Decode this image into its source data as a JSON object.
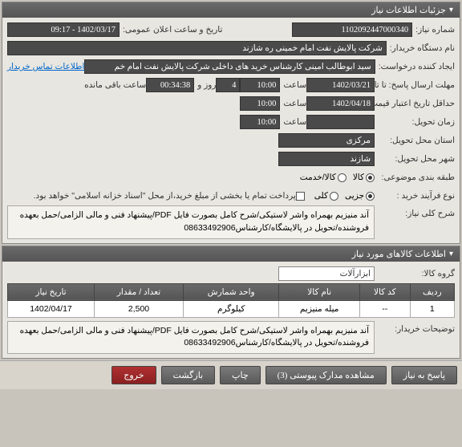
{
  "panels": {
    "detailsTitle": "جزئیات اطلاعات نیاز",
    "goodsTitle": "اطلاعات کالاهای مورد نیاز"
  },
  "labels": {
    "needNo": "شماره نیاز:",
    "buyerOrg": "نام دستگاه خریدار:",
    "requester": "ایجاد کننده درخواست:",
    "sendDue": "مهلت ارسال پاسخ: تا تاریخ:",
    "validFrom": "حداقل تاریخ اعتبار قیمت: تا تاریخ:",
    "deliveryDate": "زمان تحویل:",
    "deliveryProvince": "استان محل تحویل:",
    "deliveryCity": "شهر محل تحویل:",
    "packaging": "طبقه بندی موضوعی:",
    "buyProcess": "نوع فرآیند خرید :",
    "mainDesc": "شرح کلی نیاز:",
    "goodsGroup": "گروه کالا:",
    "buyerNotes": "توضیحات خریدار:",
    "publicDate": "تاریخ و ساعت اعلان عمومی:",
    "contactLink": "اطلاعات تماس خریدار",
    "hour": "ساعت",
    "dayAnd": "روز و",
    "remain": "ساعت باقی مانده",
    "paymentNote": "پرداخت تمام یا بخشی از مبلغ خرید،از محل \"اسناد خزانه اسلامی\" خواهد بود."
  },
  "values": {
    "needNo": "1102092447000340",
    "buyerOrg": "شرکت پالایش نفت امام خمینی ره شازند",
    "requester": "سید ابوطالب امینی کارشناس خرید های داخلی شرکت پالایش نفت امام خم",
    "publicDate": "1402/03/17 - 09:17",
    "sendDueDate": "1402/03/21",
    "sendDueTime": "10:00",
    "sendDueDays": "4",
    "sendDueClock": "00:34:38",
    "validFromDate": "1402/04/18",
    "validFromTime": "10:00",
    "deliveryTime": "10:00",
    "province": "مرکزی",
    "city": "شازند",
    "mainDesc": "آند منیزیم بهمراه واشر لاستیکی/شرح کامل بصورت فایل PDF/پیشنهاد فنی و مالی الزامی/حمل بعهده فروشنده/تحویل در پالایشگاه/کارشناس08633492906",
    "goodsGroup": "ابزارآلات",
    "buyerNotes": "آند منیزیم بهمراه واشر لاستیکی/شرح کامل بصورت فایل PDF/پیشنهاد فنی و مالی الزامی/حمل بعهده فروشنده/تحویل در پالایشگاه/کارشناس08633492906"
  },
  "radios": {
    "packaging": [
      {
        "label": "کالا",
        "selected": true
      },
      {
        "label": "کالا/خدمت",
        "selected": false
      }
    ],
    "buyProcess": [
      {
        "label": "جزیی",
        "selected": true
      },
      {
        "label": "کلی",
        "selected": false
      }
    ]
  },
  "checkbox": {
    "payment": false
  },
  "itemsTable": {
    "headers": [
      "ردیف",
      "کد کالا",
      "نام کالا",
      "واحد شمارش",
      "تعداد / مقدار",
      "تاریخ نیاز"
    ],
    "rows": [
      {
        "idx": "1",
        "code": "--",
        "name": "میله منیزیم",
        "unit": "کیلوگرم",
        "qty": "2,500",
        "date": "1402/04/17"
      }
    ]
  },
  "buttons": {
    "reply": "پاسخ به نیاز",
    "attachments": "مشاهده مدارک پیوستی (3)",
    "print": "چاپ",
    "back": "بازگشت",
    "exit": "خروج"
  }
}
